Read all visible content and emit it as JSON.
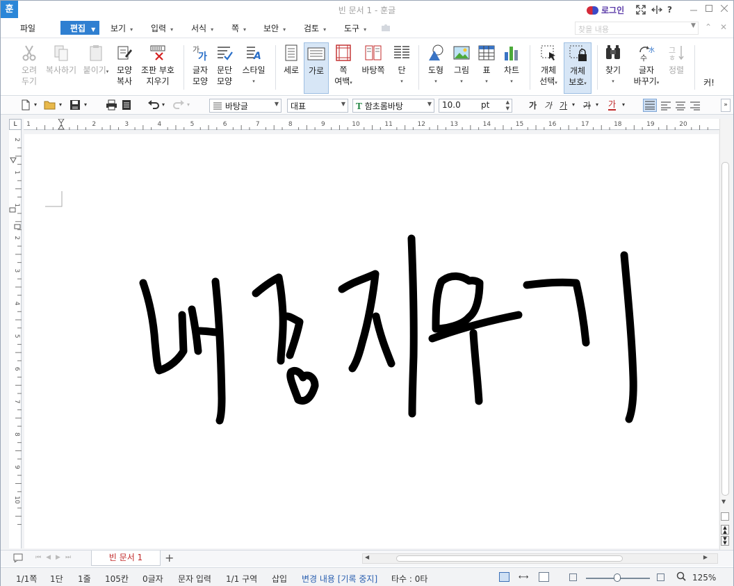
{
  "titlebar": {
    "app_icon": "훈",
    "title": "빈 문서 1 - 훈글",
    "login_label": "로그인",
    "icons": [
      "fullscreen-icon",
      "resize-icon",
      "help-icon"
    ],
    "help_label": "?",
    "window_controls": [
      "minimize",
      "maximize",
      "close"
    ]
  },
  "menubar": {
    "file": "파일",
    "active": "편집",
    "items": [
      "보기",
      "입력",
      "서식",
      "쪽",
      "보안",
      "검토",
      "도구"
    ],
    "search_placeholder": "찾을 내용"
  },
  "ribbon": {
    "cut": [
      "오려",
      "두기"
    ],
    "copy": "복사하기",
    "paste": "붙이기",
    "shape_copy": [
      "모양",
      "복사"
    ],
    "clear_marks": [
      "조판 부호",
      "지우기"
    ],
    "char_shape": [
      "글자",
      "모양"
    ],
    "para_shape": [
      "문단",
      "모양"
    ],
    "style": "스타일",
    "vertical": "세로",
    "horizontal": "가로",
    "page_margin": [
      "쪽",
      "여백"
    ],
    "background_page": "바탕쪽",
    "column": "단",
    "shape": "도형",
    "picture": "그림",
    "table": "표",
    "chart": "차트",
    "object_select": [
      "개체",
      "선택"
    ],
    "object_protect": [
      "개체",
      "보호"
    ],
    "find": "찾기",
    "replace": [
      "글자",
      "바꾸기"
    ],
    "sort": "정렬",
    "more": "커!"
  },
  "toolbar2": {
    "style_value": "바탕글",
    "lang_value": "대표",
    "font_value": "함초롬바탕",
    "size_value": "10.0",
    "size_unit": "pt",
    "char_buttons": [
      "가",
      "가",
      "가",
      "가",
      "가"
    ]
  },
  "ruler": {
    "h_ticks": [
      "1",
      "1",
      "2",
      "3",
      "4",
      "5",
      "6",
      "7",
      "8",
      "9",
      "10",
      "11",
      "12",
      "13",
      "14",
      "15",
      "16",
      "17",
      "18",
      "19",
      "20"
    ],
    "v_ticks": [
      "2",
      "1",
      "1",
      "2",
      "3",
      "4",
      "5",
      "6",
      "7",
      "8",
      "9",
      "10"
    ],
    "corner": "L"
  },
  "document": {
    "handwriting": "배경지우기"
  },
  "tabs": {
    "doc_tab": "빈 문서 1",
    "add_label": "+"
  },
  "status": {
    "page": "1/1쪽",
    "column": "1단",
    "line": "1줄",
    "col_pos": "105칸",
    "chars": "0글자",
    "input_mode": "문자 입력",
    "section": "1/1 구역",
    "insert_mode": "삽입",
    "track_changes": "변경 내용 [기록 중지]",
    "typing_count": "타수 : 0타",
    "zoom": "125%",
    "zoom_level_percent": 125
  },
  "colors": {
    "accent": "#2f7fd1",
    "tab_text": "#c02828",
    "track_changes": "#2a5fb0"
  }
}
